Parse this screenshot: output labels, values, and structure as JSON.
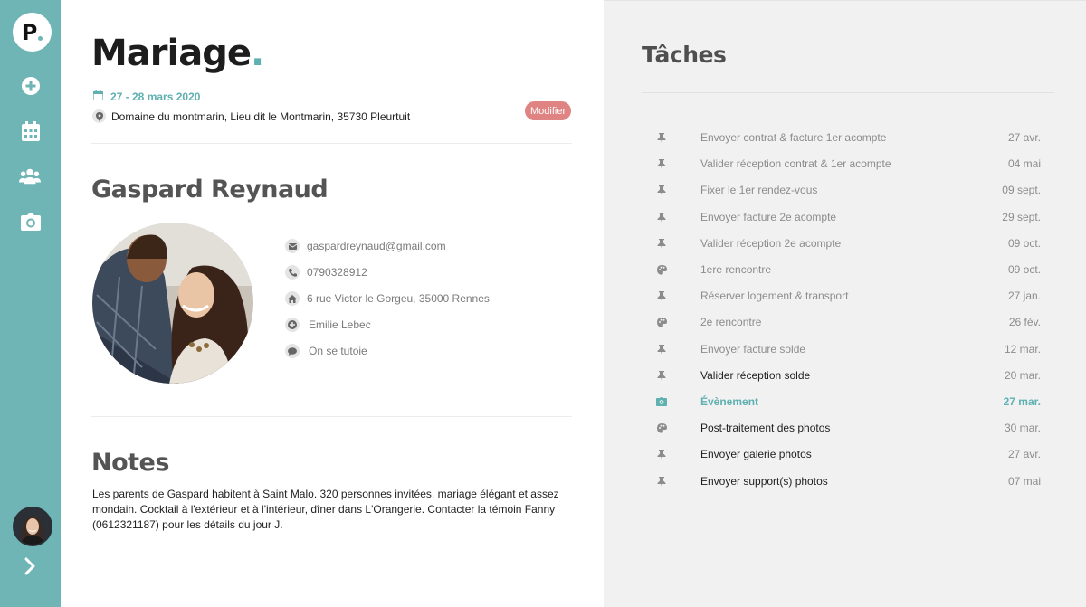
{
  "colors": {
    "accent": "#5fb0b0",
    "sidebar": "#6fb5b5",
    "modifier": "#e08383",
    "panel": "#f1f1f1"
  },
  "sidebar": {
    "logo": "P",
    "items": [
      {
        "icon": "plus-circle-icon"
      },
      {
        "icon": "calendar-icon"
      },
      {
        "icon": "users-icon"
      },
      {
        "icon": "camera-icon"
      }
    ],
    "expand_icon": "chevron-right-icon"
  },
  "event": {
    "title": "Mariage",
    "title_dot": ".",
    "dates": "27 - 28 mars 2020",
    "location": "Domaine du montmarin, Lieu dit le Montmarin, 35730 Pleurtuit",
    "modify_label": "Modifier"
  },
  "client": {
    "name": "Gaspard Reynaud",
    "email": "gaspardreynaud@gmail.com",
    "phone": "0790328912",
    "address": "6 rue Victor le Gorgeu, 35000 Rennes",
    "referrer": "Emilie Lebec",
    "note": "On se tutoie"
  },
  "notes": {
    "title": "Notes",
    "text": "Les parents de Gaspard habitent à Saint Malo. 320 personnes invitées, mariage élégant et assez mondain. Cocktail à l'extérieur et à l'intérieur, dîner dans L'Orangerie. Contacter la témoin Fanny (0612321187) pour les détails du jour J."
  },
  "tasks": {
    "title": "Tâches",
    "items": [
      {
        "icon": "pin-icon",
        "label": "Envoyer contrat & facture 1er acompte",
        "date": "27 avr.",
        "state": "done"
      },
      {
        "icon": "pin-icon",
        "label": "Valider réception contrat & 1er acompte",
        "date": "04 mai",
        "state": "done"
      },
      {
        "icon": "pin-icon",
        "label": "Fixer le 1er rendez-vous",
        "date": "09 sept.",
        "state": "done"
      },
      {
        "icon": "pin-icon",
        "label": "Envoyer facture 2e acompte",
        "date": "29 sept.",
        "state": "done"
      },
      {
        "icon": "pin-icon",
        "label": "Valider réception 2e acompte",
        "date": "09 oct.",
        "state": "done"
      },
      {
        "icon": "palette-icon",
        "label": "1ere rencontre",
        "date": "09 oct.",
        "state": "done"
      },
      {
        "icon": "pin-icon",
        "label": "Réserver logement & transport",
        "date": "27 jan.",
        "state": "done"
      },
      {
        "icon": "palette-icon",
        "label": "2e rencontre",
        "date": "26 fév.",
        "state": "done"
      },
      {
        "icon": "pin-icon",
        "label": "Envoyer facture solde",
        "date": "12 mar.",
        "state": "done"
      },
      {
        "icon": "pin-icon",
        "label": "Valider réception solde",
        "date": "20 mar.",
        "state": "pending"
      },
      {
        "icon": "camera-icon",
        "label": "Évènement",
        "date": "27 mar.",
        "state": "active"
      },
      {
        "icon": "palette-icon",
        "label": "Post-traitement des photos",
        "date": "30 mar.",
        "state": "pending"
      },
      {
        "icon": "pin-icon",
        "label": "Envoyer galerie photos",
        "date": "27 avr.",
        "state": "pending"
      },
      {
        "icon": "pin-icon",
        "label": "Envoyer support(s) photos",
        "date": "07 mai",
        "state": "pending"
      }
    ]
  }
}
